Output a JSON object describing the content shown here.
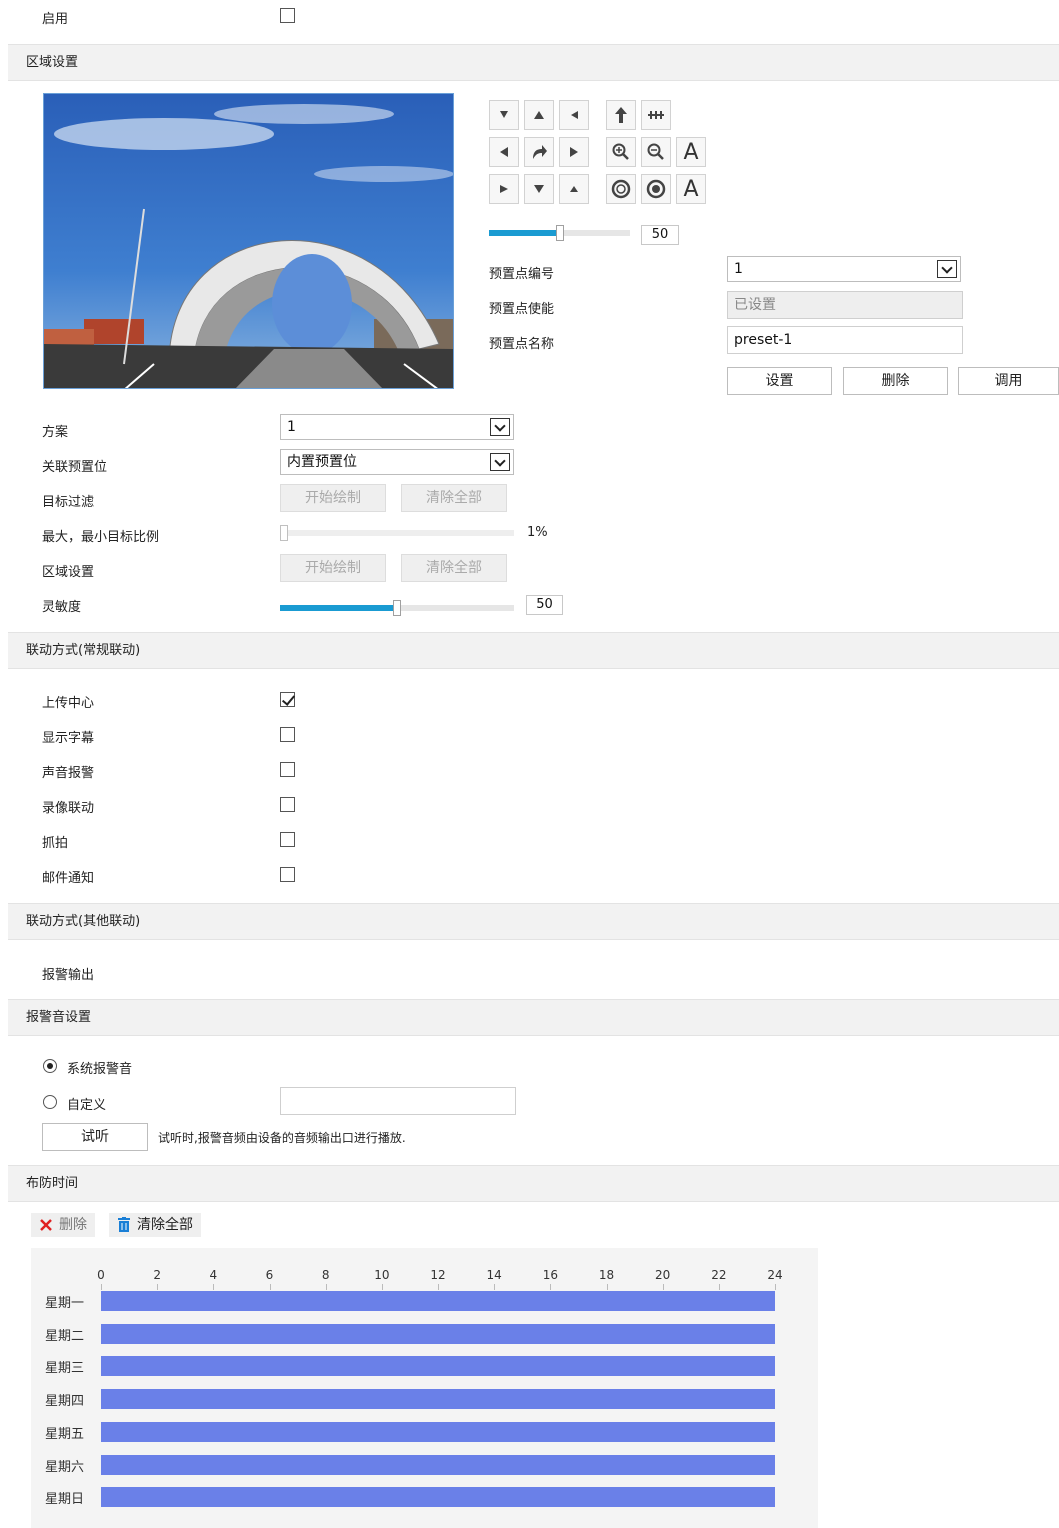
{
  "enable": {
    "label": "启用",
    "checked": false
  },
  "region_section": {
    "title": "区域设置"
  },
  "ptz": {
    "icons": [
      "arrow-up-left-icon",
      "arrow-up-icon",
      "arrow-up-right-icon",
      "focus-near-icon",
      "focus-far-icon",
      "arrow-left-icon",
      "rotate-icon",
      "arrow-right-icon",
      "zoom-in-icon",
      "zoom-out-icon",
      "auto-focus-icon",
      "arrow-down-left-icon",
      "arrow-down-icon",
      "arrow-down-right-icon",
      "iris-open-icon",
      "iris-close-icon",
      "auto-iris-icon"
    ],
    "auto_glyph": "A",
    "speed_value": "50",
    "speed_fraction": 0.5
  },
  "preset": {
    "number_label": "预置点编号",
    "number_value": "1",
    "enable_label": "预置点使能",
    "enable_value": "已设置",
    "name_label": "预置点名称",
    "name_value": "preset-1",
    "set_button": "设置",
    "delete_button": "删除",
    "call_button": "调用"
  },
  "config": {
    "plan_label": "方案",
    "plan_value": "1",
    "linked_preset_label": "关联预置位",
    "linked_preset_value": "内置预置位",
    "target_filter_label": "目标过滤",
    "start_draw": "开始绘制",
    "clear_all": "清除全部",
    "ratio_label": "最大，最小目标比例",
    "ratio_value": "1%",
    "ratio_fraction": 0.01,
    "area_label": "区域设置",
    "start_draw_2": "开始绘制",
    "clear_all_2": "清除全部",
    "sensitivity_label": "灵敏度",
    "sensitivity_value": "50",
    "sensitivity_fraction": 0.5
  },
  "linkage_normal": {
    "title": "联动方式(常规联动)",
    "items": [
      {
        "label": "上传中心",
        "checked": true
      },
      {
        "label": "显示字幕",
        "checked": false
      },
      {
        "label": "声音报警",
        "checked": false
      },
      {
        "label": "录像联动",
        "checked": false
      },
      {
        "label": "抓拍",
        "checked": false
      },
      {
        "label": "邮件通知",
        "checked": false
      }
    ]
  },
  "linkage_other": {
    "title": "联动方式(其他联动)",
    "alarm_output_label": "报警输出"
  },
  "alarm_sound": {
    "title": "报警音设置",
    "system_label": "系统报警音",
    "custom_label": "自定义",
    "custom_value": "",
    "listen_button": "试听",
    "listen_hint": "试听时,报警音频由设备的音频输出口进行播放."
  },
  "schedule": {
    "title": "布防时间",
    "delete_label": "删除",
    "clear_label": "清除全部",
    "hours": [
      "0",
      "2",
      "4",
      "6",
      "8",
      "10",
      "12",
      "14",
      "16",
      "18",
      "20",
      "22",
      "24"
    ],
    "days": [
      "星期一",
      "星期二",
      "星期三",
      "星期四",
      "星期五",
      "星期六",
      "星期日"
    ],
    "bar_color": "#6a80e8"
  }
}
